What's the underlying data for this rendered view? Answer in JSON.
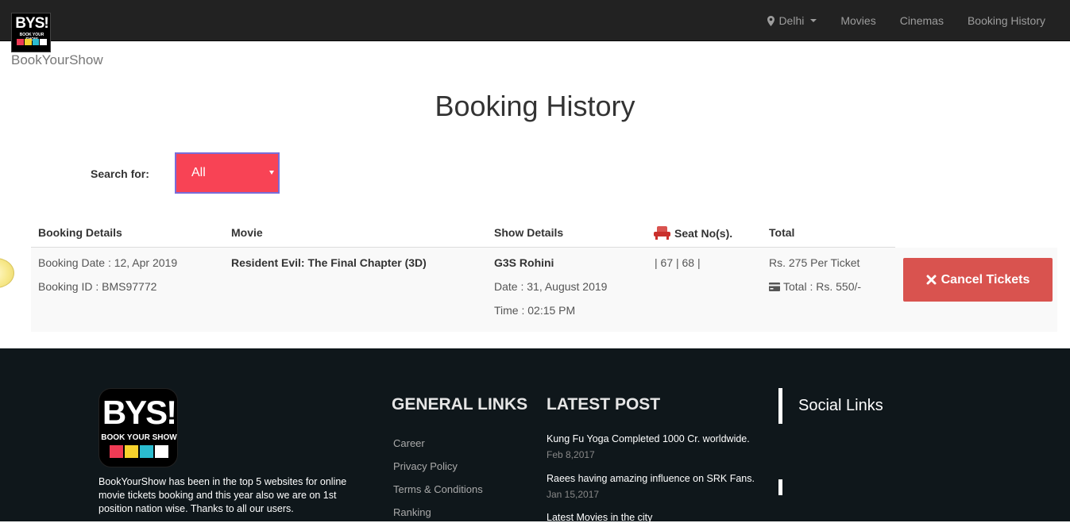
{
  "brand": {
    "logo_big": "BYS!",
    "logo_small": "BOOK YOUR SHOW",
    "name": "BookYourShow",
    "colors": [
      "#ef3b55",
      "#f6d22d",
      "#2bbccf",
      "#ffffff"
    ]
  },
  "nav": {
    "location": "Delhi",
    "items": [
      {
        "label": "Movies"
      },
      {
        "label": "Cinemas"
      },
      {
        "label": "Booking History"
      }
    ]
  },
  "page": {
    "title": "Booking History",
    "search_label": "Search for:",
    "search_value": "All"
  },
  "table": {
    "headers": {
      "booking": "Booking Details",
      "movie": "Movie",
      "show": "Show Details",
      "seats": "Seat No(s).",
      "total": "Total"
    },
    "rows": [
      {
        "booking_date": "Booking Date : 12, Apr 2019",
        "booking_id": "Booking ID : BMS97772",
        "movie": "Resident Evil: The Final Chapter (3D)",
        "cinema": "G3S Rohini",
        "show_date": "Date : 31, August 2019",
        "show_time": "Time : 02:15 PM",
        "seats": "| 67 | 68 |",
        "per_ticket": "Rs. 275 Per Ticket",
        "total": "Total : Rs. 550/-",
        "cancel_label": "Cancel Tickets"
      }
    ]
  },
  "footer": {
    "about": "BookYourShow has been in the top 5 websites for online movie tickets booking and this year also we are on 1st position nation wise. Thanks to all our users.",
    "general_links_title": "GENERAL LINKS",
    "general_links": [
      "Career",
      "Privacy Policy",
      "Terms & Conditions",
      "Ranking"
    ],
    "latest_post_title": "LATEST POST",
    "posts": [
      {
        "title": "Kung Fu Yoga Completed 1000 Cr. worldwide.",
        "date": "Feb 8,2017"
      },
      {
        "title": "Raees having amazing influence on SRK Fans.",
        "date": "Jan 15,2017"
      },
      {
        "title": "Latest Movies in the city",
        "date": ""
      }
    ],
    "social_title": "Social Links"
  },
  "colors": {
    "navbar": "#222222",
    "select_bg": "#f84355",
    "cancel_button": "#d9534f",
    "footer_bg": "#0f171b"
  }
}
